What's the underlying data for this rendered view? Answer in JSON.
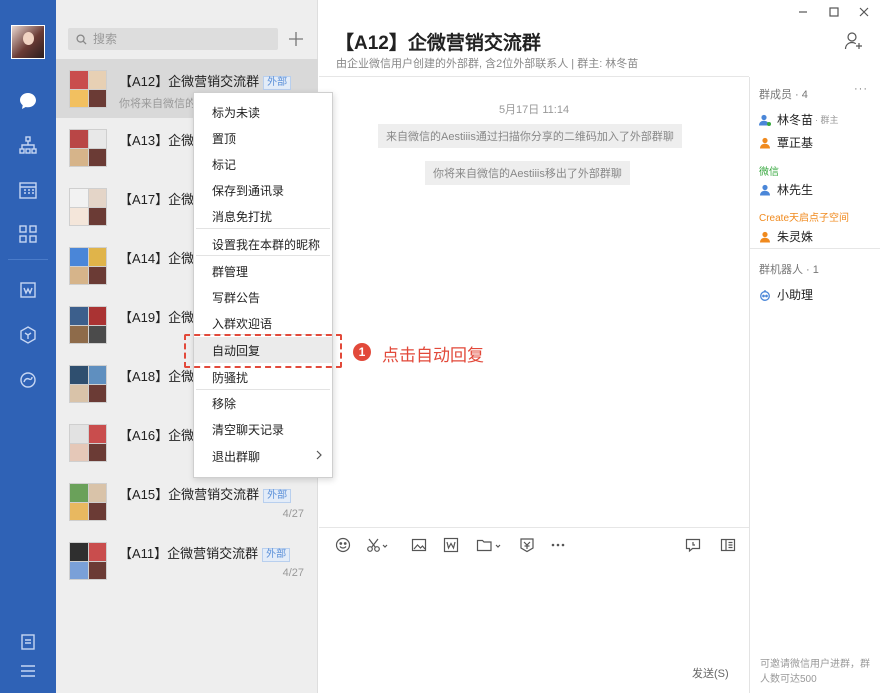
{
  "nav": {
    "items": [
      "chat",
      "org",
      "calendar",
      "apps",
      "doc",
      "workbench",
      "cloud-drive"
    ]
  },
  "list": {
    "search_placeholder": "搜索",
    "add_label": "+",
    "external_tag": "外部",
    "conversations": [
      {
        "name": "【A12】企微营销交流群",
        "snippet": "你将来自微信的",
        "date": "",
        "tag": true,
        "selected": true
      },
      {
        "name": "【A13】企微",
        "snippet": "",
        "date": "",
        "tag": false,
        "selected": false
      },
      {
        "name": "【A17】企微",
        "snippet": "",
        "date": "",
        "tag": false,
        "selected": false
      },
      {
        "name": "【A14】企微",
        "snippet": "",
        "date": "",
        "tag": false,
        "selected": false
      },
      {
        "name": "【A19】企微",
        "snippet": "",
        "date": "",
        "tag": false,
        "selected": false
      },
      {
        "name": "【A18】企微",
        "snippet": "",
        "date": "",
        "tag": false,
        "selected": false
      },
      {
        "name": "【A16】企微",
        "snippet": "",
        "date": "",
        "tag": false,
        "selected": false
      },
      {
        "name": "【A15】企微营销交流群",
        "snippet": "",
        "date": "4/27",
        "tag": true,
        "selected": false
      },
      {
        "name": "【A11】企微营销交流群",
        "snippet": "",
        "date": "4/27",
        "tag": true,
        "selected": false
      }
    ]
  },
  "context_menu": {
    "items": [
      "标为未读",
      "置顶",
      "标记",
      "保存到通讯录",
      "消息免打扰",
      "设置我在本群的昵称",
      "群管理",
      "写群公告",
      "入群欢迎语",
      "自动回复",
      "防骚扰",
      "移除",
      "清空聊天记录",
      "退出群聊"
    ],
    "highlighted": "自动回复"
  },
  "callout": {
    "number": "1",
    "text": "点击自动回复"
  },
  "chat": {
    "title": "【A12】企微营销交流群",
    "subtitle": "由企业微信用户创建的外部群, 含2位外部联系人 | 群主: 林冬苗",
    "time": "5月17日 11:14",
    "system_messages": [
      "来自微信的Aestiiis通过扫描你分享的二维码加入了外部群聊",
      "你将来自微信的Aestiiis移出了外部群聊"
    ],
    "send_label": "发送(S)"
  },
  "panel": {
    "members_title": "群成员 · 4",
    "more": "···",
    "owner": {
      "name": "林冬苗",
      "role": "· 群主"
    },
    "member2": "覃正基",
    "wechat_group": "微信",
    "wechat_member": "林先生",
    "create_group": "Create天启点子空间",
    "create_member": "朱灵姝",
    "bots_title": "群机器人 · 1",
    "bot": "小助理",
    "footer": "可邀请微信用户进群，群人数可达500"
  },
  "colors": {
    "nav_bg": "#2f62b6",
    "accent": "#4a86d8",
    "callout": "#e2493a",
    "wechat_green": "#37a83f",
    "create_orange": "#f08a1e"
  }
}
